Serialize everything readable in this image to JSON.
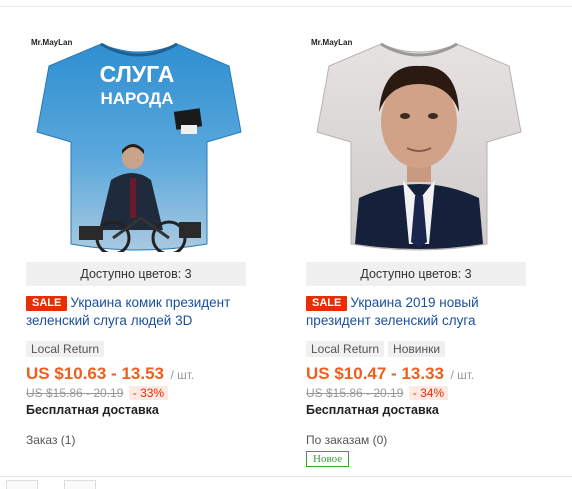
{
  "products": [
    {
      "brand": "Mr.MayLan",
      "shirt_text_line1": "СЛУГА",
      "shirt_text_line2": "НАРОДА",
      "colors_available": "Доступно цветов: 3",
      "sale_badge": "SALE",
      "title": "Украина комик президент зеленский слуга людей 3D",
      "tags": [
        "Local Return"
      ],
      "price": "US $10.63 - 13.53",
      "price_unit": "/ шт.",
      "old_price": "US $15.86 - 20.19",
      "discount": "- 33%",
      "shipping": "Бесплатная доставка",
      "orders": "Заказ (1)",
      "new_badge": ""
    },
    {
      "brand": "Mr.MayLan",
      "colors_available": "Доступно цветов: 3",
      "sale_badge": "SALE",
      "title": "Украина 2019 новый президент зеленский слуга",
      "tags": [
        "Local Return",
        "Новинки"
      ],
      "price": "US $10.47 - 13.33",
      "price_unit": "/ шт.",
      "old_price": "US $15.86 - 20.19",
      "discount": "- 34%",
      "shipping": "Бесплатная доставка",
      "orders": "По заказам (0)",
      "new_badge": "Новое"
    }
  ],
  "colors": {
    "price": "#f05d1e",
    "sale": "#e62e04",
    "link": "#1a4f9c",
    "new_badge": "#33a533"
  }
}
